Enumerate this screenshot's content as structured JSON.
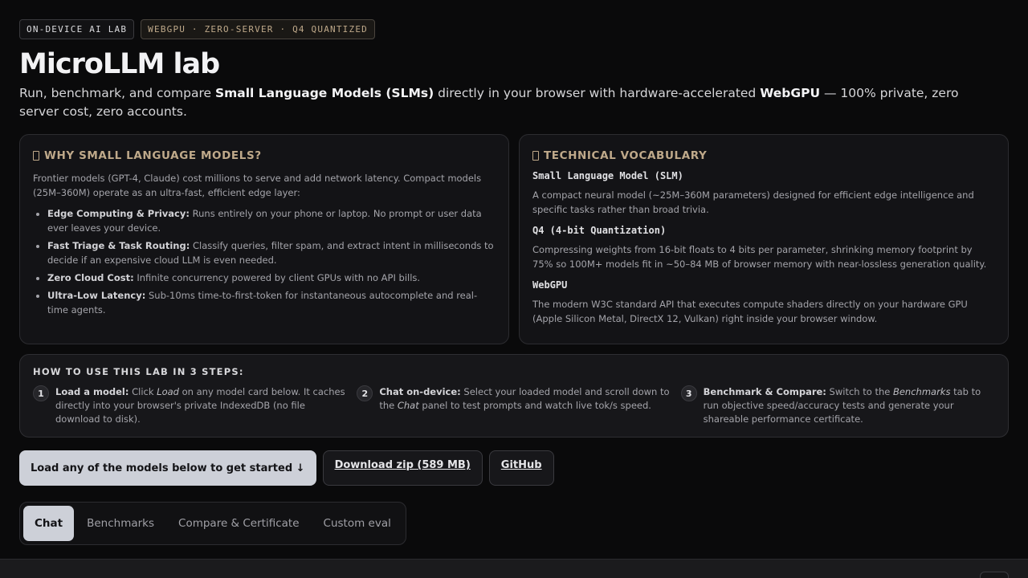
{
  "badges": {
    "primary": "ON-DEVICE AI LAB",
    "accent": "WEBGPU · ZERO-SERVER · Q4 QUANTIZED"
  },
  "header": {
    "title": "MicroLLM lab",
    "lead_1": "Run, benchmark, and compare ",
    "lead_b1": "Small Language Models (SLMs)",
    "lead_2": " directly in your browser with hardware-accelerated ",
    "lead_b2": "WebGPU",
    "lead_3": " — 100% private, zero server cost, zero accounts."
  },
  "why_card": {
    "title": "WHY SMALL LANGUAGE MODELS?",
    "intro": "Frontier models (GPT-4, Claude) cost millions to serve and add network latency. Compact models (25M–360M) operate as an ultra-fast, efficient edge layer:",
    "items": [
      {
        "label": "Edge Computing & Privacy:",
        "text": " Runs entirely on your phone or laptop. No prompt or user data ever leaves your device."
      },
      {
        "label": "Fast Triage & Task Routing:",
        "text": " Classify queries, filter spam, and extract intent in milliseconds to decide if an expensive cloud LLM is even needed."
      },
      {
        "label": "Zero Cloud Cost:",
        "text": " Infinite concurrency powered by client GPUs with no API bills."
      },
      {
        "label": "Ultra-Low Latency:",
        "text": " Sub-10ms time-to-first-token for instantaneous autocomplete and real-time agents."
      }
    ]
  },
  "vocab_card": {
    "title": "TECHNICAL VOCABULARY",
    "terms": [
      {
        "term": "Small Language Model (SLM)",
        "def": "A compact neural model (~25M–360M parameters) designed for efficient edge intelligence and specific tasks rather than broad trivia."
      },
      {
        "term": "Q4 (4-bit Quantization)",
        "def": "Compressing weights from 16-bit floats to 4 bits per parameter, shrinking memory footprint by 75% so 100M+ models fit in ~50–84 MB of browser memory with near-lossless generation quality."
      },
      {
        "term": "WebGPU",
        "def": "The modern W3C standard API that executes compute shaders directly on your hardware GPU (Apple Silicon Metal, DirectX 12, Vulkan) right inside your browser window."
      }
    ]
  },
  "steps": {
    "title": "HOW TO USE THIS LAB IN 3 STEPS:",
    "items": [
      {
        "num": "1",
        "label": "Load a model:",
        "t1": " Click ",
        "em": "Load",
        "t2": " on any model card below. It caches directly into your browser's private IndexedDB (no file download to disk)."
      },
      {
        "num": "2",
        "label": "Chat on-device:",
        "t1": " Select your loaded model and scroll down to the ",
        "em": "Chat",
        "t2": " panel to test prompts and watch live tok/s speed."
      },
      {
        "num": "3",
        "label": "Benchmark & Compare:",
        "t1": " Switch to the ",
        "em": "Benchmarks",
        "t2": " tab to run objective speed/accuracy tests and generate your shareable performance certificate."
      }
    ]
  },
  "actions": {
    "load": "Load any of the models below to get started ↓",
    "download": "Download zip (589 MB)",
    "github": "GitHub"
  },
  "tabs": [
    {
      "label": "Chat",
      "active": true
    },
    {
      "label": "Benchmarks",
      "active": false
    },
    {
      "label": "Compare & Certificate",
      "active": false
    },
    {
      "label": "Custom eval",
      "active": false
    }
  ],
  "icons": {
    "why_card": "box-icon",
    "vocab_card": "box-icon"
  },
  "colors": {
    "background": "#0a0a0b",
    "accent": "#bfa98a",
    "primary_button": "#cdd0d8"
  }
}
